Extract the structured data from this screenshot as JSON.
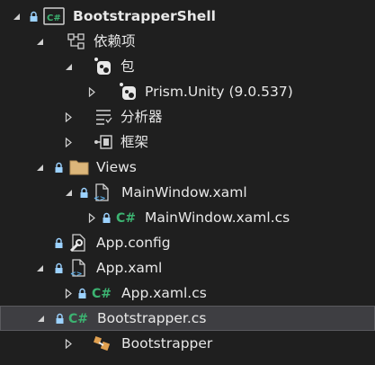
{
  "colors": {
    "background": "#1f1f1f",
    "selected_background": "#3e3e42",
    "text": "#e8e8e8",
    "csharp_green": "#3cb371",
    "lock_blue": "#9cd2ff",
    "folder_yellow": "#dcb67a"
  },
  "tree": {
    "items": [
      {
        "label": "BootstrapperShell",
        "icon": "csharp-project-icon",
        "expanded": true,
        "depth": 0
      },
      {
        "label": "依赖项",
        "icon": "dependencies-icon",
        "expanded": true,
        "depth": 1
      },
      {
        "label": "包",
        "icon": "nuget-package-icon",
        "expanded": true,
        "depth": 2
      },
      {
        "label": "Prism.Unity (9.0.537)",
        "icon": "nuget-package-icon",
        "expanded": false,
        "depth": 3
      },
      {
        "label": "分析器",
        "icon": "analyzer-icon",
        "expanded": false,
        "depth": 2
      },
      {
        "label": "框架",
        "icon": "framework-icon",
        "expanded": false,
        "depth": 2
      },
      {
        "label": "Views",
        "icon": "folder-icon",
        "expanded": true,
        "depth": 1
      },
      {
        "label": "MainWindow.xaml",
        "icon": "xaml-file-icon",
        "expanded": true,
        "depth": 2
      },
      {
        "label": "MainWindow.xaml.cs",
        "icon": "csharp-file-icon",
        "expanded": false,
        "depth": 3
      },
      {
        "label": "App.config",
        "icon": "config-file-icon",
        "expanded": null,
        "depth": 1
      },
      {
        "label": "App.xaml",
        "icon": "xaml-file-icon",
        "expanded": true,
        "depth": 1
      },
      {
        "label": "App.xaml.cs",
        "icon": "csharp-file-icon",
        "expanded": false,
        "depth": 2
      },
      {
        "label": "Bootstrapper.cs",
        "icon": "csharp-file-icon",
        "expanded": true,
        "depth": 1,
        "selected": true
      },
      {
        "label": "Bootstrapper",
        "icon": "class-icon",
        "expanded": false,
        "depth": 2
      }
    ]
  }
}
